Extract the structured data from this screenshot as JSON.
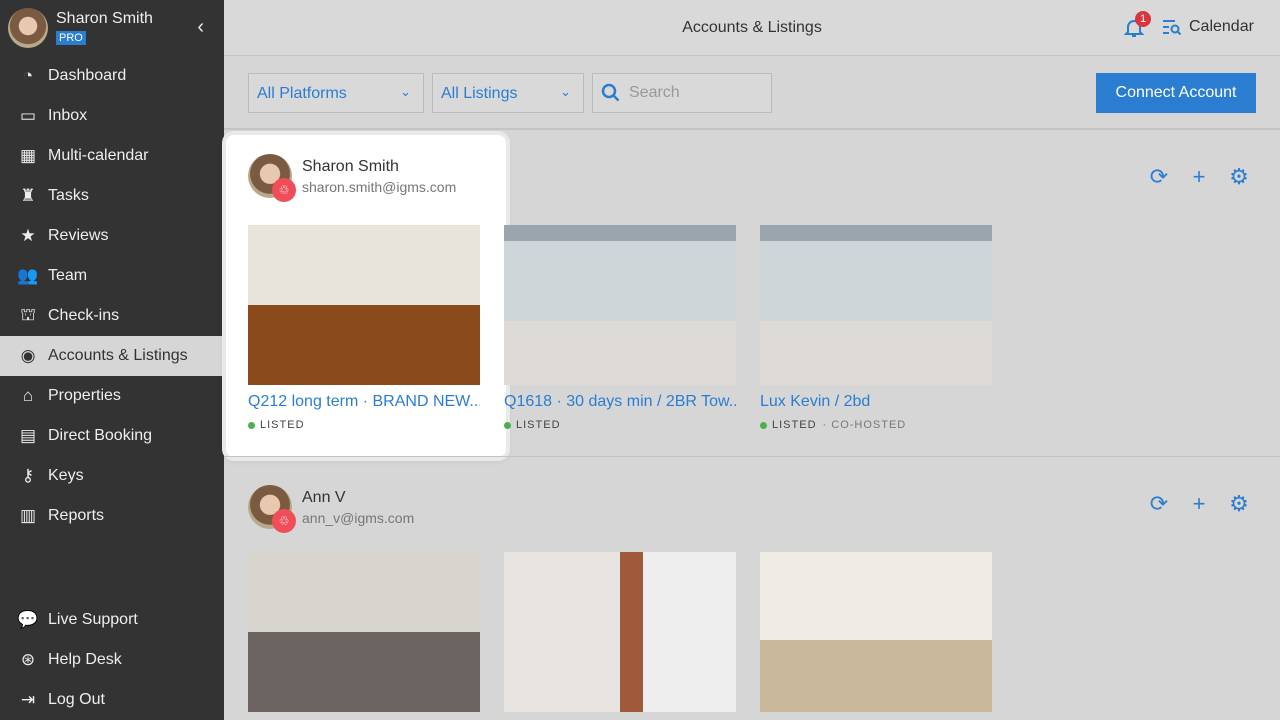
{
  "user": {
    "name": "Sharon Smith",
    "plan": "PRO"
  },
  "sidebar": {
    "items": [
      {
        "label": "Dashboard",
        "icon": "dashboard-icon",
        "glyph": "◔"
      },
      {
        "label": "Inbox",
        "icon": "inbox-icon",
        "glyph": "▭"
      },
      {
        "label": "Multi-calendar",
        "icon": "calendar-icon",
        "glyph": "▦"
      },
      {
        "label": "Tasks",
        "icon": "tasks-icon",
        "glyph": "♜"
      },
      {
        "label": "Reviews",
        "icon": "star-icon",
        "glyph": "★"
      },
      {
        "label": "Team",
        "icon": "team-icon",
        "glyph": "👥"
      },
      {
        "label": "Check-ins",
        "icon": "bell-concierge-icon",
        "glyph": "⛫"
      },
      {
        "label": "Accounts & Listings",
        "icon": "user-circle-icon",
        "glyph": "◉"
      },
      {
        "label": "Properties",
        "icon": "home-icon",
        "glyph": "⌂"
      },
      {
        "label": "Direct Booking",
        "icon": "code-window-icon",
        "glyph": "▤"
      },
      {
        "label": "Keys",
        "icon": "key-icon",
        "glyph": "⚷"
      },
      {
        "label": "Reports",
        "icon": "bar-chart-icon",
        "glyph": "▥"
      }
    ],
    "bottom": [
      {
        "label": "Live Support",
        "icon": "chat-icon",
        "glyph": "💬"
      },
      {
        "label": "Help Desk",
        "icon": "lifebuoy-icon",
        "glyph": "⊛"
      },
      {
        "label": "Log Out",
        "icon": "logout-icon",
        "glyph": "⇥"
      }
    ]
  },
  "header": {
    "title": "Accounts & Listings",
    "notifications": "1",
    "calendar_label": "Calendar"
  },
  "filters": {
    "platforms": "All Platforms",
    "listings": "All Listings",
    "search_placeholder": "Search",
    "connect_label": "Connect Account"
  },
  "accounts": [
    {
      "name": "Sharon Smith",
      "email": "sharon.smith@igms.com",
      "listings": [
        {
          "title": "Q212 long term · BRAND NEW...",
          "status": "LISTED"
        },
        {
          "title": "Q1618 · 30 days min / 2BR Tow...",
          "status": "LISTED"
        },
        {
          "title": "Lux Kevin / 2bd",
          "status": "LISTED",
          "extra": "CO-HOSTED"
        }
      ]
    },
    {
      "name": "Ann V",
      "email": "ann_v@igms.com",
      "listings": [
        {},
        {},
        {}
      ]
    }
  ],
  "colors": {
    "accent": "#2a7dd1",
    "sidebar": "#333333",
    "airbnb": "#ef4e58",
    "listed": "#4caf50"
  }
}
